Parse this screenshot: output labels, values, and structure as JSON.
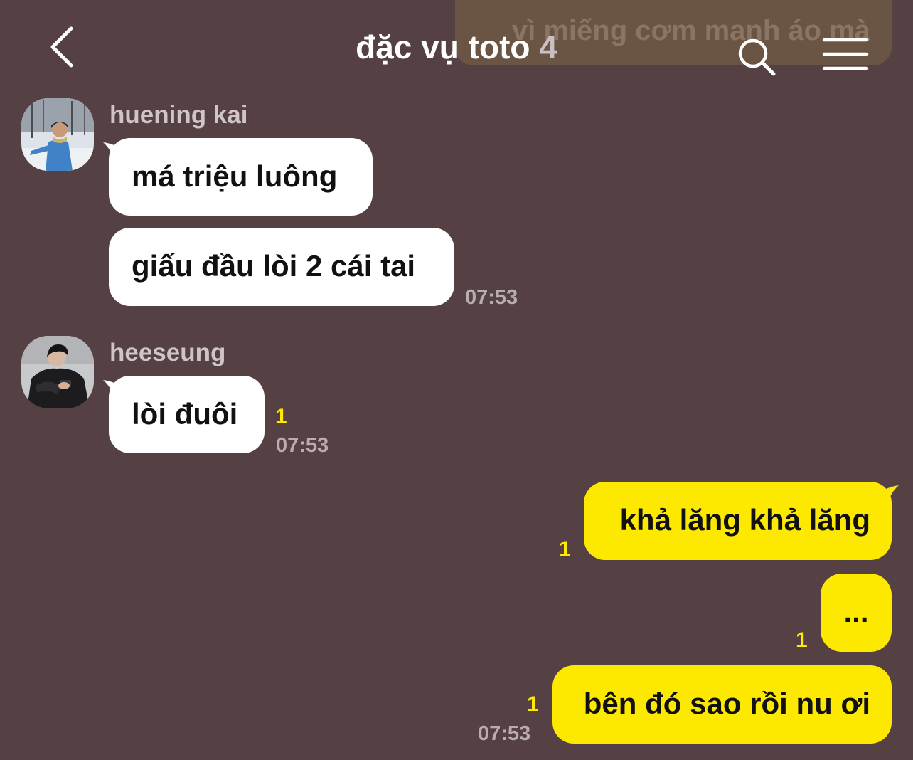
{
  "header": {
    "pinned_text": "vì miếng cơm manh áo mà",
    "title": "đặc vụ toto",
    "member_count": "4"
  },
  "messages": {
    "group1": {
      "sender": "huening kai",
      "bubble1": "má triệu luông",
      "bubble2": "giấu đầu lòi 2 cái tai",
      "time": "07:53"
    },
    "group2": {
      "sender": "heeseung",
      "bubble1": "lòi đuôi",
      "unread": "1",
      "time": "07:53"
    },
    "outgoing": {
      "bubble1": "khả lăng khả lăng",
      "unread1": "1",
      "bubble2": "...",
      "unread2": "1",
      "bubble3": "bên đó sao rồi nu ơi",
      "unread3": "1",
      "time": "07:53"
    }
  },
  "colors": {
    "background": "#554143",
    "outgoing_bubble": "#fde800",
    "incoming_bubble": "#ffffff",
    "unread_count": "#fde800"
  },
  "icons": {
    "back": "chevron-left-icon",
    "search": "search-icon",
    "menu": "hamburger-menu-icon"
  }
}
